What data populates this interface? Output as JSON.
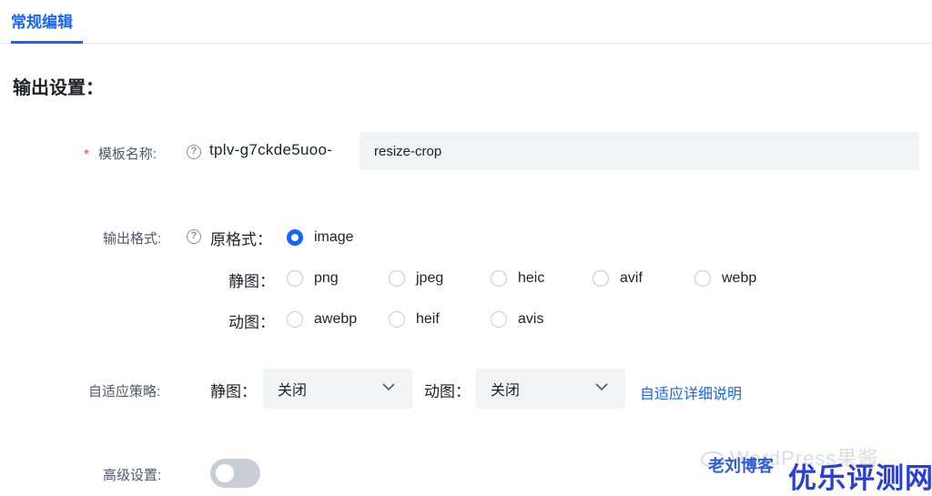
{
  "tabs": [
    {
      "label": "常规编辑",
      "active": true
    }
  ],
  "section": {
    "title": "输出设置："
  },
  "template_name": {
    "label": "模板名称:",
    "prefix": "tplv-g7ckde5uoo-",
    "value": "resize-crop"
  },
  "output_format": {
    "label": "输出格式:",
    "original": {
      "label": "原格式：",
      "options": [
        {
          "label": "image",
          "checked": true
        }
      ]
    },
    "static": {
      "label": "静图：",
      "options": [
        {
          "label": "png",
          "checked": false
        },
        {
          "label": "jpeg",
          "checked": false
        },
        {
          "label": "heic",
          "checked": false
        },
        {
          "label": "avif",
          "checked": false
        },
        {
          "label": "webp",
          "checked": false
        }
      ]
    },
    "animated": {
      "label": "动图：",
      "options": [
        {
          "label": "awebp",
          "checked": false
        },
        {
          "label": "heif",
          "checked": false
        },
        {
          "label": "avis",
          "checked": false
        }
      ]
    }
  },
  "adaptive": {
    "label": "自适应策略:",
    "static_label": "静图：",
    "static_value": "关闭",
    "animated_label": "动图：",
    "animated_value": "关闭",
    "link": "自适应详细说明"
  },
  "advanced": {
    "label": "高级设置:",
    "enabled": false
  },
  "watermark": {
    "faint": "WordPress果酱",
    "blue": "老刘博客",
    "big": "优乐评测网"
  },
  "colors": {
    "accent": "#1664ff",
    "required": "#f53f3f",
    "input_bg": "#f2f3f5"
  }
}
